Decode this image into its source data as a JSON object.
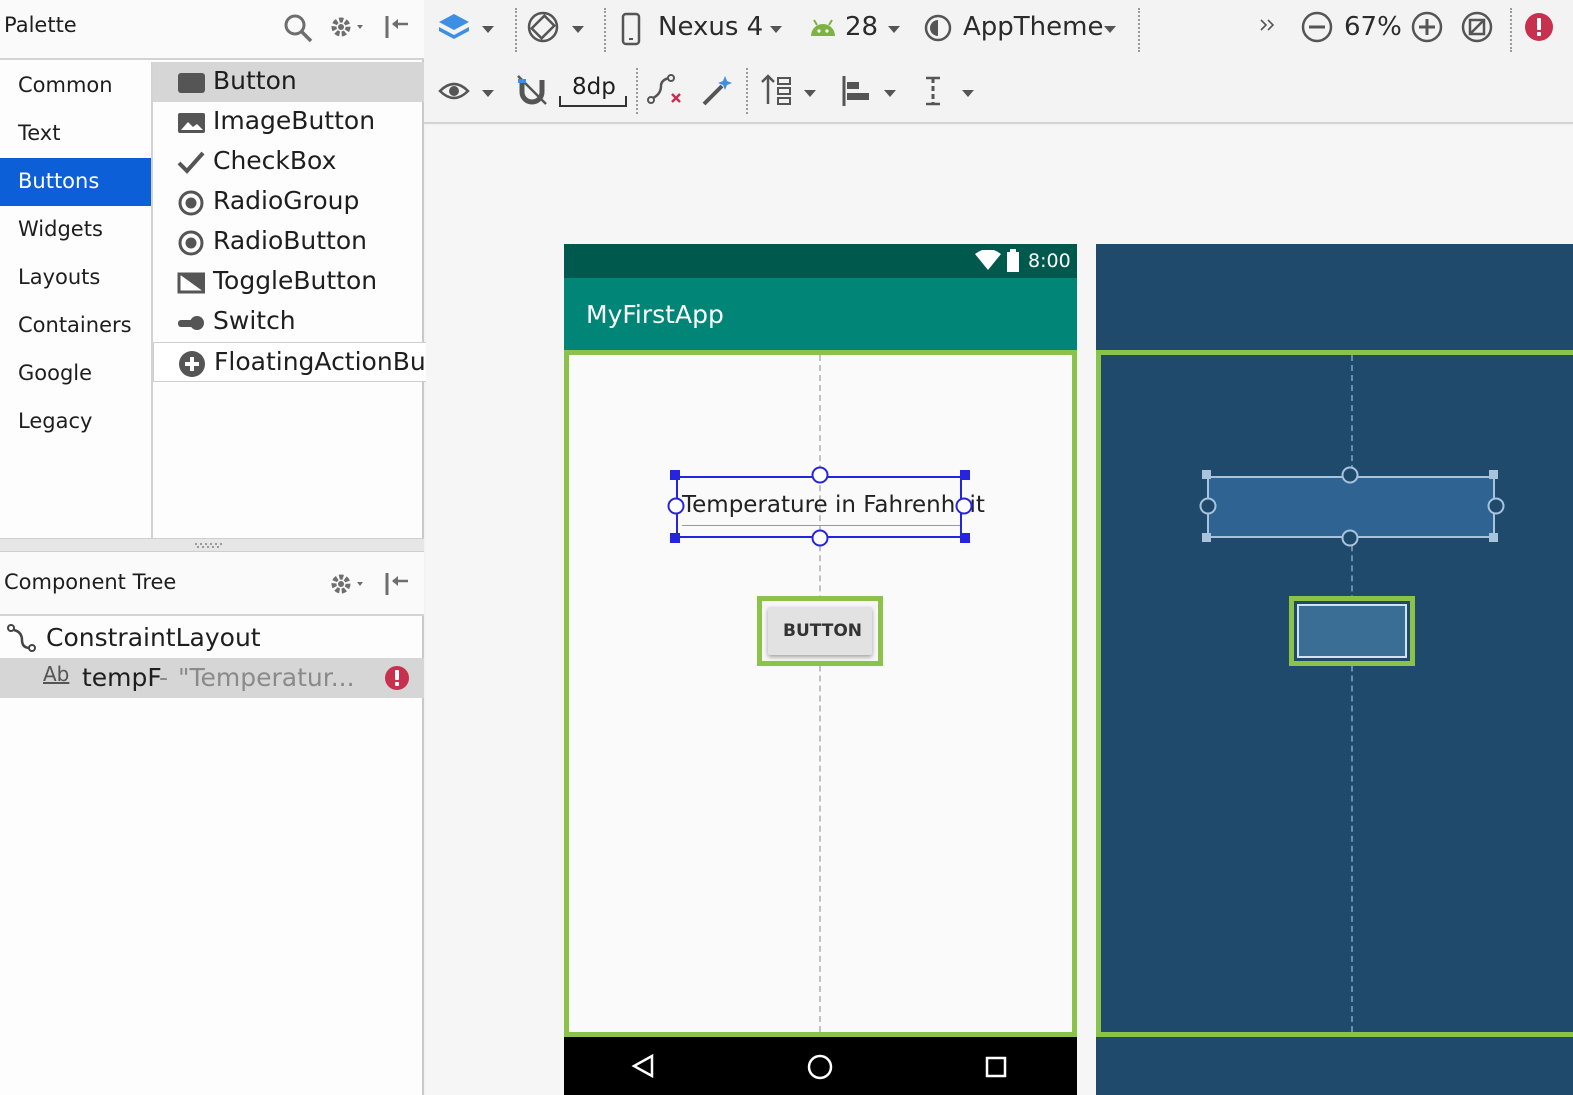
{
  "palette": {
    "title": "Palette",
    "categories": [
      "Common",
      "Text",
      "Buttons",
      "Widgets",
      "Layouts",
      "Containers",
      "Google",
      "Legacy"
    ],
    "selected_category": "Buttons",
    "items": [
      {
        "label": "Button",
        "icon": "button-icon"
      },
      {
        "label": "ImageButton",
        "icon": "image-icon"
      },
      {
        "label": "CheckBox",
        "icon": "checkmark-icon"
      },
      {
        "label": "RadioGroup",
        "icon": "radio-icon"
      },
      {
        "label": "RadioButton",
        "icon": "radio-icon"
      },
      {
        "label": "ToggleButton",
        "icon": "toggle-icon"
      },
      {
        "label": "Switch",
        "icon": "switch-icon"
      },
      {
        "label": "FloatingActionButton",
        "icon": "plus-circle-icon"
      }
    ]
  },
  "tree": {
    "title": "Component Tree",
    "root": "ConstraintLayout",
    "child": {
      "prefix": "Ab",
      "id": "tempF",
      "sep": "-",
      "text": "\"Temperatur..."
    }
  },
  "toolbar": {
    "device": "Nexus 4",
    "api": "28",
    "theme": "AppTheme",
    "zoom": "67%",
    "margin": "8dp"
  },
  "device": {
    "time": "8:00",
    "app_title": "MyFirstApp",
    "edit_text": "Temperature in Fahrenheit",
    "button_label": "BUTTON"
  },
  "colors": {
    "selection": "#0d5fd8",
    "status_bar": "#00594d",
    "app_bar": "#008577",
    "blueprint": "#204a6b",
    "constraint_green": "#8bc34a",
    "error": "#c8304f"
  }
}
